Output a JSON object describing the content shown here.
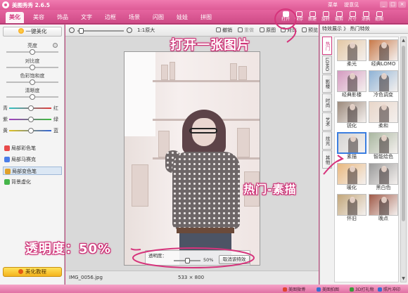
{
  "window": {
    "title": "美图秀秀 2.6.5",
    "links": [
      "菜单",
      "提意见"
    ],
    "controls": [
      "_",
      "□",
      "×"
    ]
  },
  "tabs": [
    {
      "label": "美化",
      "active": true
    },
    {
      "label": "美容"
    },
    {
      "label": "饰品"
    },
    {
      "label": "文字"
    },
    {
      "label": "边框"
    },
    {
      "label": "场景"
    },
    {
      "label": "闪图"
    },
    {
      "label": "娃娃"
    },
    {
      "label": "拼图"
    }
  ],
  "toolbar_buttons": [
    {
      "label": "打开",
      "icon": "open-folder-icon"
    },
    {
      "label": "保存",
      "icon": "save-icon"
    },
    {
      "label": "新建",
      "icon": "new-file-icon"
    },
    {
      "label": "旋转",
      "icon": "rotate-icon"
    },
    {
      "label": "裁剪",
      "icon": "crop-icon"
    },
    {
      "label": "尺寸",
      "icon": "resize-icon"
    },
    {
      "label": "涂鸦",
      "icon": "doodle-icon"
    },
    {
      "label": "抠图",
      "icon": "cutout-icon"
    }
  ],
  "left_panel": {
    "one_key": "一键美化",
    "adjustments": [
      "亮度",
      "对比度",
      "色彩饱和度",
      "清晰度"
    ],
    "color_balance": [
      {
        "left": "青",
        "right": "红",
        "color_left": "#2ec4c4",
        "color_right": "#e23a3a"
      },
      {
        "left": "紫",
        "right": "绿",
        "color_left": "#a43cc4",
        "color_right": "#3cbf3c"
      },
      {
        "left": "黄",
        "right": "蓝",
        "color_left": "#e0c21e",
        "color_right": "#2e62d8"
      }
    ],
    "tools": [
      {
        "label": "局部彩色笔",
        "color": "#e84a4a"
      },
      {
        "label": "局部马赛克",
        "color": "#4a7de8"
      },
      {
        "label": "局部变色笔",
        "color": "#e0a02a",
        "selected": true
      },
      {
        "label": "背景虚化",
        "color": "#45b54a"
      }
    ],
    "tutorial": "美化教程"
  },
  "work_toolbar": {
    "zoom_label": "1:1原大",
    "undo": "撤销",
    "redo": "重做",
    "original": "原图",
    "compare": "对比",
    "preview": "预览"
  },
  "opacity_popup": {
    "label": "透明度：",
    "value_text": "50%",
    "value": 0.5,
    "cancel_button": "取消该特效"
  },
  "status": {
    "filename": "IMG_0056.jpg",
    "dimensions": "533 × 800"
  },
  "right_panel": {
    "header": "特效展示 》 热门特效",
    "vertical_tabs": [
      "热门",
      "LOMO",
      "影楼",
      "时尚",
      "艺术",
      "炫光",
      "其他"
    ],
    "effects": [
      {
        "label": "柔光",
        "tint": "#e3c7a4"
      },
      {
        "label": "经典LOMO",
        "tint": "#c87a4a"
      },
      {
        "label": "经典影楼",
        "tint": "#d49ac0"
      },
      {
        "label": "冷色调变",
        "tint": "#8fb3d6"
      },
      {
        "label": "锐化",
        "tint": "#9c8a7c"
      },
      {
        "label": "柔和",
        "tint": "#e8d6c9"
      },
      {
        "label": "素描",
        "tint": "#d4d4d4",
        "selected": true
      },
      {
        "label": "智能绘色",
        "tint": "#a9b7a0"
      },
      {
        "label": "暖化",
        "tint": "#e9b87f"
      },
      {
        "label": "黑白色",
        "tint": "#9b9b9b"
      },
      {
        "label": "怀旧",
        "tint": "#c2a67a"
      },
      {
        "label": "晚点",
        "tint": "#a05a48"
      }
    ]
  },
  "bottom_bar": [
    {
      "label": "美图微博",
      "color": "#e0452f"
    },
    {
      "label": "美图拍图",
      "color": "#3a70d0"
    },
    {
      "label": "3D打礼物",
      "color": "#3a9a3a"
    },
    {
      "label": "照片冲印",
      "color": "#3a70d0"
    }
  ],
  "annotations": {
    "open": "打开一张图片",
    "hot": "热门-素描",
    "opacity": "透明度：50%"
  },
  "colors": {
    "accent": "#e45a97",
    "annotation": "#d6337b"
  }
}
